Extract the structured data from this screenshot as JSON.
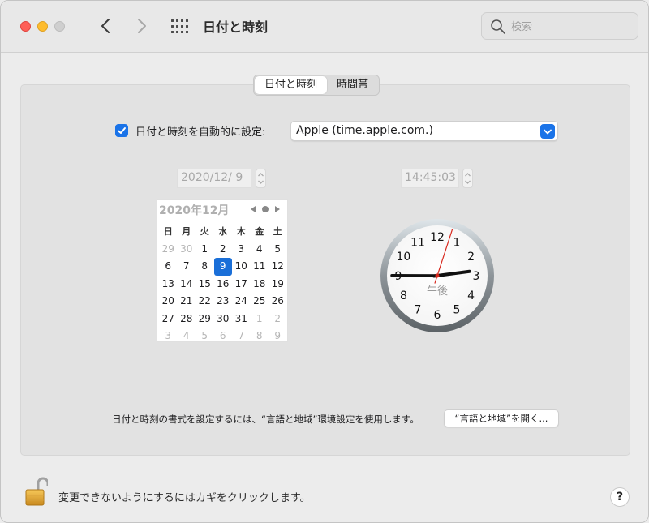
{
  "window": {
    "title": "日付と時刻",
    "search_placeholder": "検索"
  },
  "tabs": [
    {
      "label": "日付と時刻",
      "active": true
    },
    {
      "label": "時間帯",
      "active": false
    }
  ],
  "auto_set": {
    "checked": true,
    "label": "日付と時刻を自動的に設定:",
    "server": "Apple (time.apple.com.)"
  },
  "date_field": "2020/12/  9",
  "time_field": "14:45:03",
  "calendar": {
    "title": "2020年12月",
    "weekdays": [
      "日",
      "月",
      "火",
      "水",
      "木",
      "金",
      "土"
    ],
    "weeks": [
      [
        {
          "d": "29",
          "dim": true
        },
        {
          "d": "30",
          "dim": true
        },
        {
          "d": "1"
        },
        {
          "d": "2"
        },
        {
          "d": "3"
        },
        {
          "d": "4"
        },
        {
          "d": "5"
        }
      ],
      [
        {
          "d": "6"
        },
        {
          "d": "7"
        },
        {
          "d": "8"
        },
        {
          "d": "9",
          "selected": true
        },
        {
          "d": "10"
        },
        {
          "d": "11"
        },
        {
          "d": "12"
        }
      ],
      [
        {
          "d": "13"
        },
        {
          "d": "14"
        },
        {
          "d": "15"
        },
        {
          "d": "16"
        },
        {
          "d": "17"
        },
        {
          "d": "18"
        },
        {
          "d": "19"
        }
      ],
      [
        {
          "d": "20"
        },
        {
          "d": "21"
        },
        {
          "d": "22"
        },
        {
          "d": "23"
        },
        {
          "d": "24"
        },
        {
          "d": "25"
        },
        {
          "d": "26"
        }
      ],
      [
        {
          "d": "27"
        },
        {
          "d": "28"
        },
        {
          "d": "29"
        },
        {
          "d": "30"
        },
        {
          "d": "31"
        },
        {
          "d": "1",
          "dim": true
        },
        {
          "d": "2",
          "dim": true
        }
      ],
      [
        {
          "d": "3",
          "dim": true
        },
        {
          "d": "4",
          "dim": true
        },
        {
          "d": "5",
          "dim": true
        },
        {
          "d": "6",
          "dim": true
        },
        {
          "d": "7",
          "dim": true
        },
        {
          "d": "8",
          "dim": true
        },
        {
          "d": "9",
          "dim": true
        }
      ]
    ]
  },
  "clock": {
    "numbers": [
      "12",
      "1",
      "2",
      "3",
      "4",
      "5",
      "6",
      "7",
      "8",
      "9",
      "10",
      "11"
    ],
    "ampm": "午後",
    "hour": 14,
    "minute": 45,
    "second": 3
  },
  "format_note": "日付と時刻の書式を設定するには、“言語と地域”環境設定を使用します。",
  "open_button": "“言語と地域”を開く...",
  "lock_text": "変更できないようにするにはカギをクリックします。",
  "help_label": "?",
  "colors": {
    "accent": "#1a73e8",
    "close": "#fe5f57",
    "minimize": "#febc2e"
  }
}
